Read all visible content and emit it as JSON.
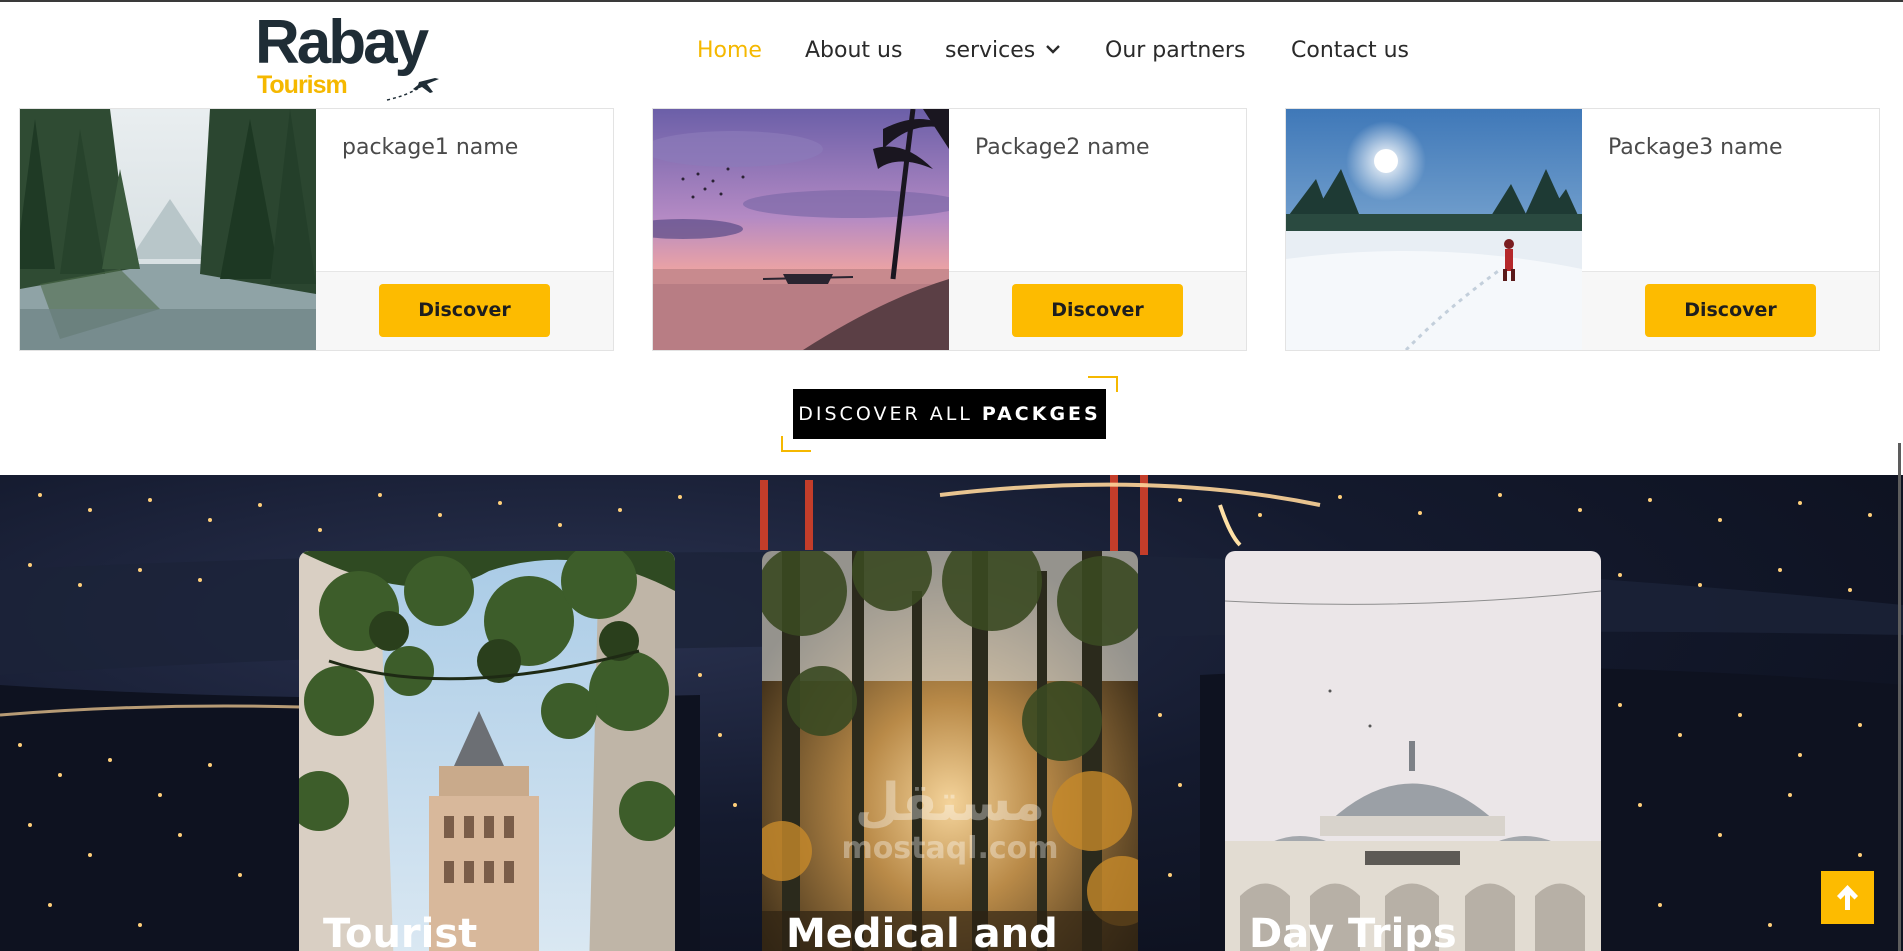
{
  "header": {
    "logo_main": "Rabay",
    "logo_sub": "Tourism",
    "nav": [
      {
        "label": "Home",
        "active": true
      },
      {
        "label": "About us",
        "active": false
      },
      {
        "label": "services",
        "active": false,
        "icon": "chevron-down-icon"
      },
      {
        "label": "Our partners",
        "active": false
      },
      {
        "label": "Contact us",
        "active": false
      }
    ]
  },
  "packages": [
    {
      "name": "package1 name",
      "button": "Discover",
      "image": "forest-lake"
    },
    {
      "name": "Package2 name",
      "button": "Discover",
      "image": "tropical-sunset-beach"
    },
    {
      "name": "Package3 name",
      "button": "Discover",
      "image": "snowy-forest-hiker"
    }
  ],
  "discover_all": {
    "text_normal": "DISCOVER ALL ",
    "text_bold": "PACKGES"
  },
  "services": [
    {
      "title": "Tourist",
      "image": "galata-tower"
    },
    {
      "title": "Medical and",
      "image": "pine-forest-sunlight"
    },
    {
      "title": "Day Trips",
      "image": "mosque-dome"
    }
  ],
  "watermark": {
    "arabic": "مستقل",
    "latin": "mostaql.com"
  },
  "colors": {
    "accent": "#fdbb00",
    "nav_active": "#f5b800",
    "dark": "#1f2d36"
  },
  "icons": {
    "scroll_top": "arrow-up-icon",
    "logo": "airplane-icon"
  }
}
